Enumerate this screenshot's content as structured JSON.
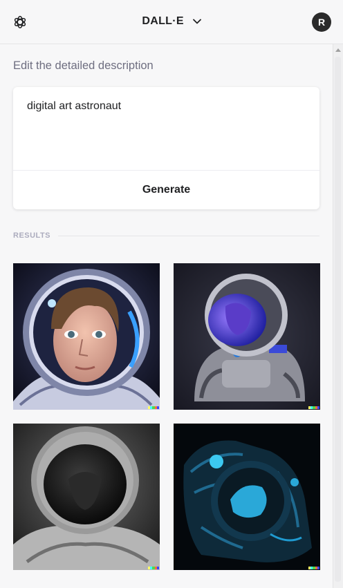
{
  "header": {
    "logo_icon": "openai-logo-icon",
    "title": "DALL·E",
    "menu_icon": "chevron-down-icon",
    "avatar_initial": "R"
  },
  "editor": {
    "heading": "Edit the detailed description",
    "prompt_text": "digital art astronaut",
    "generate_label": "Generate"
  },
  "results": {
    "label": "RESULTS",
    "images": [
      {
        "name": "astronaut-portrait-brown-hair"
      },
      {
        "name": "astronaut-blue-visor-gray-suit"
      },
      {
        "name": "astronaut-grayscale-dark-visor"
      },
      {
        "name": "astronaut-blue-neon-black"
      }
    ]
  },
  "colors": {
    "background": "#f7f7f8",
    "text": "#202123",
    "muted": "#6e6e80",
    "watermark": [
      "#ffff66",
      "#42ffff",
      "#51da4c",
      "#ff6e3c",
      "#3c46ff"
    ]
  }
}
